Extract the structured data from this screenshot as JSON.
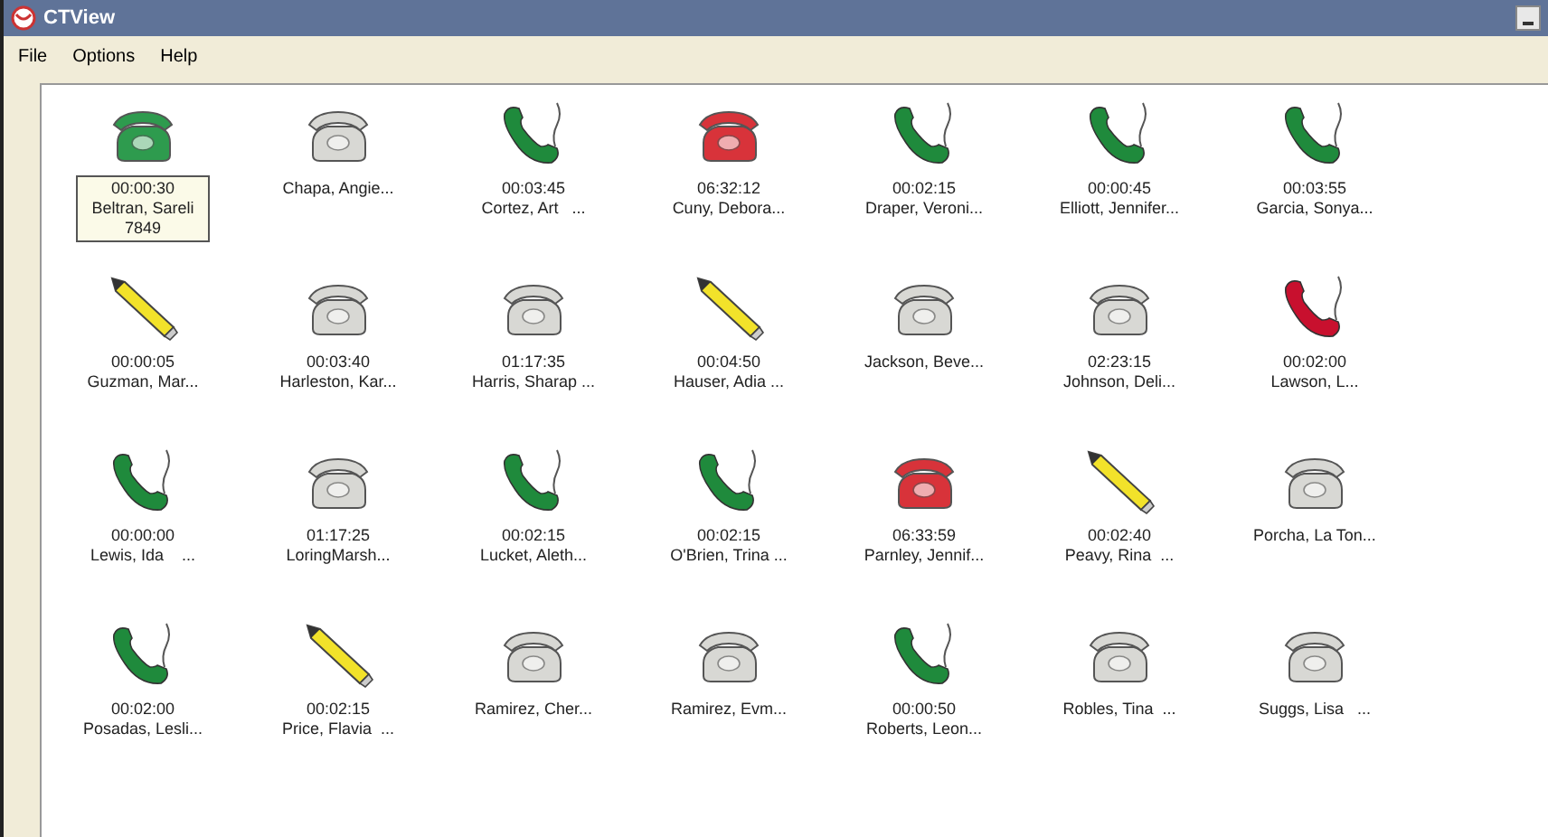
{
  "window": {
    "title": "CTView"
  },
  "menu": [
    "File",
    "Options",
    "Help"
  ],
  "agents": [
    {
      "kind": "desk",
      "color": "#2e9b4e",
      "time": "00:00:30",
      "name": "Beltran, Sareli",
      "extension": "7849",
      "selected": true
    },
    {
      "kind": "desk",
      "color": "#d8d8d4",
      "name": "Chapa, Angie...",
      "selected": false
    },
    {
      "kind": "handset",
      "color": "#1f8a3c",
      "time": "00:03:45",
      "name": "Cortez, Art   ...",
      "selected": false
    },
    {
      "kind": "desk",
      "color": "#d8333a",
      "time": "06:32:12",
      "name": "Cuny, Debora...",
      "selected": false
    },
    {
      "kind": "handset",
      "color": "#1f8a3c",
      "time": "00:02:15",
      "name": "Draper, Veroni...",
      "selected": false
    },
    {
      "kind": "handset",
      "color": "#1f8a3c",
      "time": "00:00:45",
      "name": "Elliott, Jennifer...",
      "selected": false
    },
    {
      "kind": "handset",
      "color": "#1f8a3c",
      "time": "00:03:55",
      "name": "Garcia, Sonya...",
      "selected": false
    },
    {
      "kind": "pencil",
      "time": "00:00:05",
      "name": "Guzman, Mar...",
      "selected": false
    },
    {
      "kind": "desk",
      "color": "#d8d8d4",
      "time": "00:03:40",
      "name": "Harleston, Kar...",
      "selected": false
    },
    {
      "kind": "desk",
      "color": "#d8d8d4",
      "time": "01:17:35",
      "name": "Harris, Sharap ...",
      "selected": false
    },
    {
      "kind": "pencil",
      "time": "00:04:50",
      "name": "Hauser, Adia ...",
      "selected": false
    },
    {
      "kind": "desk",
      "color": "#d8d8d4",
      "name": "Jackson, Beve...",
      "selected": false
    },
    {
      "kind": "desk",
      "color": "#d8d8d4",
      "time": "02:23:15",
      "name": "Johnson, Deli...",
      "selected": false
    },
    {
      "kind": "handset",
      "color": "#c8102e",
      "time": "00:02:00",
      "name": "Lawson, L...",
      "selected": false
    },
    {
      "kind": "handset",
      "color": "#1f8a3c",
      "time": "00:00:00",
      "name": "Lewis, Ida    ...",
      "selected": false
    },
    {
      "kind": "desk",
      "color": "#d8d8d4",
      "time": "01:17:25",
      "name": "LoringMarsh...",
      "selected": false
    },
    {
      "kind": "handset",
      "color": "#1f8a3c",
      "time": "00:02:15",
      "name": "Lucket, Aleth...",
      "selected": false
    },
    {
      "kind": "handset",
      "color": "#1f8a3c",
      "time": "00:02:15",
      "name": "O'Brien, Trina ...",
      "selected": false
    },
    {
      "kind": "desk",
      "color": "#d8333a",
      "time": "06:33:59",
      "name": "Parnley, Jennif...",
      "selected": false
    },
    {
      "kind": "pencil",
      "time": "00:02:40",
      "name": "Peavy, Rina  ...",
      "selected": false
    },
    {
      "kind": "desk",
      "color": "#d8d8d4",
      "name": "Porcha, La Ton...",
      "selected": false
    },
    {
      "kind": "handset",
      "color": "#1f8a3c",
      "time": "00:02:00",
      "name": "Posadas, Lesli...",
      "selected": false
    },
    {
      "kind": "pencil",
      "time": "00:02:15",
      "name": "Price, Flavia  ...",
      "selected": false
    },
    {
      "kind": "desk",
      "color": "#d8d8d4",
      "name": "Ramirez, Cher...",
      "selected": false
    },
    {
      "kind": "desk",
      "color": "#d8d8d4",
      "name": "Ramirez, Evm...",
      "selected": false
    },
    {
      "kind": "handset",
      "color": "#1f8a3c",
      "time": "00:00:50",
      "name": "Roberts, Leon...",
      "selected": false
    },
    {
      "kind": "desk",
      "color": "#d8d8d4",
      "name": "Robles, Tina  ...",
      "selected": false
    },
    {
      "kind": "desk",
      "color": "#d8d8d4",
      "name": "Suggs, Lisa   ...",
      "selected": false
    }
  ]
}
